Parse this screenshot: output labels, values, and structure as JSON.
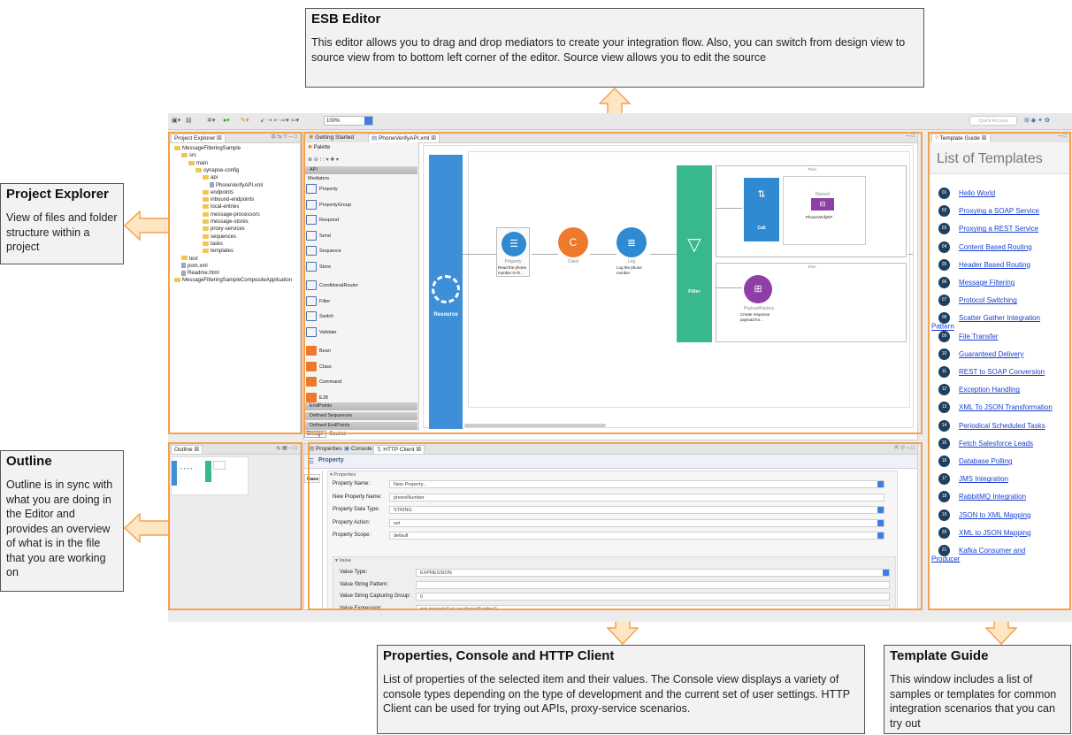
{
  "callouts": {
    "esb_editor": {
      "title": "ESB Editor",
      "text": "This editor allows you to drag and drop mediators to create your integration flow. Also, you can switch from design view to source view from to bottom left corner of the editor. Source view allows you to edit the source"
    },
    "project_explorer": {
      "title": "Project Explorer",
      "text": "View of files and folder structure within a project"
    },
    "outline": {
      "title": "Outline",
      "text": "Outline is in sync with what you are doing in the Editor and provides an overview of what is in the file that you are working on"
    },
    "properties": {
      "title": "Properties, Console and HTTP Client",
      "text": "List of properties of the selected item and their values. The Console view displays a variety of console types depending on the type of development and the current set of user settings. HTTP Client can be used for trying out APIs, proxy-service scenarios."
    },
    "template_guide": {
      "title": "Template Guide",
      "text": "This window includes a list of samples or templates for common integration scenarios that you can try out"
    }
  },
  "toolbar": {
    "zoom": "100%",
    "quick_access": "Quick Access"
  },
  "project_explorer": {
    "tab": "Project Explorer",
    "tree": [
      {
        "label": "MessageFilteringSample",
        "indent": 0,
        "kind": "folder"
      },
      {
        "label": "src",
        "indent": 1,
        "kind": "folder"
      },
      {
        "label": "main",
        "indent": 2,
        "kind": "folder"
      },
      {
        "label": "synapse-config",
        "indent": 3,
        "kind": "folder"
      },
      {
        "label": "api",
        "indent": 4,
        "kind": "folder"
      },
      {
        "label": "PhoneVerifyAPI.xml",
        "indent": 5,
        "kind": "file"
      },
      {
        "label": "endpoints",
        "indent": 4,
        "kind": "folder"
      },
      {
        "label": "inbound-endpoints",
        "indent": 4,
        "kind": "folder"
      },
      {
        "label": "local-entries",
        "indent": 4,
        "kind": "folder"
      },
      {
        "label": "message-processors",
        "indent": 4,
        "kind": "folder"
      },
      {
        "label": "message-stores",
        "indent": 4,
        "kind": "folder"
      },
      {
        "label": "proxy-services",
        "indent": 4,
        "kind": "folder"
      },
      {
        "label": "sequences",
        "indent": 4,
        "kind": "folder"
      },
      {
        "label": "tasks",
        "indent": 4,
        "kind": "folder"
      },
      {
        "label": "templates",
        "indent": 4,
        "kind": "folder"
      },
      {
        "label": "test",
        "indent": 1,
        "kind": "folder"
      },
      {
        "label": "pom.xml",
        "indent": 1,
        "kind": "file"
      },
      {
        "label": "Readme.html",
        "indent": 1,
        "kind": "file"
      },
      {
        "label": "MessageFilteringSampleCompositeApplication",
        "indent": 0,
        "kind": "folder"
      }
    ]
  },
  "editor": {
    "tabs": [
      "Getting Started",
      "PhoneVerifyAPI.xml"
    ],
    "palette_label": "Palette",
    "sections": {
      "api": "API",
      "mediators": "Mediators",
      "endpoints": "EndPoints",
      "defined_sequences": "Defined Sequences",
      "defined_endpoints": "Defined EndPoints"
    },
    "mediators": [
      "Property",
      "PropertyGroup",
      "Respond",
      "Send",
      "Sequence",
      "Store",
      "ConditionalRouter",
      "Filter",
      "Switch",
      "Validate",
      "Bean",
      "Class",
      "Command",
      "EJB"
    ],
    "bottom_tabs": [
      "Design",
      "Source"
    ],
    "canvas": {
      "resource": "Resource",
      "property": {
        "label": "Property",
        "desc": "Read the phone number in th..."
      },
      "class": {
        "label": "Class"
      },
      "log": {
        "label": "Log",
        "desc": "Log the phone number"
      },
      "filter": "Filter",
      "then": "Then",
      "else": "Else",
      "call": "Call",
      "named": "Named",
      "endpoint": "PhoneVerifyEP",
      "payload": {
        "label": "PayloadFactory",
        "desc": "Create response payload for..."
      }
    }
  },
  "outline": {
    "tab": "Outline"
  },
  "bottom": {
    "tabs": [
      "Properties",
      "Console",
      "HTTP Client"
    ],
    "header": "Property",
    "side_tab": "Base",
    "group": "Properties",
    "fields": [
      {
        "label": "Property Name:",
        "value": "New Property...",
        "type": "select"
      },
      {
        "label": "New Property Name:",
        "value": "phoneNumber",
        "type": "text"
      },
      {
        "label": "Property Data Type:",
        "value": "STRING",
        "type": "select"
      },
      {
        "label": "Property Action:",
        "value": "set",
        "type": "select"
      },
      {
        "label": "Property Scope:",
        "value": "default",
        "type": "select"
      }
    ],
    "value_group": "Value",
    "value_fields": [
      {
        "label": "Value Type:",
        "value": "EXPRESSION",
        "type": "select"
      },
      {
        "label": "Value String Pattern:",
        "value": "",
        "type": "text"
      },
      {
        "label": "Value String Capturing Group:",
        "value": "0",
        "type": "text"
      },
      {
        "label": "Value Expression:",
        "value": "get-property('uri.var.phoneNumber')",
        "type": "text"
      }
    ]
  },
  "template_guide": {
    "tab": "Template Guide",
    "heading": "List of Templates",
    "items": [
      {
        "num": "01",
        "label": "Hello World"
      },
      {
        "num": "02",
        "label": "Proxying a SOAP Service"
      },
      {
        "num": "03",
        "label": "Proxying a REST Service"
      },
      {
        "num": "04",
        "label": "Content Based Routing"
      },
      {
        "num": "05",
        "label": "Header Based Routing"
      },
      {
        "num": "06",
        "label": "Message Filtering"
      },
      {
        "num": "07",
        "label": "Protocol Switching"
      },
      {
        "num": "08",
        "label": "Scatter Gather Integration",
        "label2": "Pattern"
      },
      {
        "num": "09",
        "label": "File Transfer"
      },
      {
        "num": "10",
        "label": "Guaranteed Delivery"
      },
      {
        "num": "11",
        "label": "REST to SOAP Conversion"
      },
      {
        "num": "12",
        "label": "Exception Handling"
      },
      {
        "num": "13",
        "label": "XML To JSON Transformation"
      },
      {
        "num": "14",
        "label": "Periodical Scheduled Tasks"
      },
      {
        "num": "15",
        "label": "Fetch Salesforce Leads"
      },
      {
        "num": "16",
        "label": "Database Polling"
      },
      {
        "num": "17",
        "label": "JMS Integration"
      },
      {
        "num": "18",
        "label": "RabbitMQ Integration"
      },
      {
        "num": "19",
        "label": "JSON to XML Mapping"
      },
      {
        "num": "20",
        "label": "XML to JSON Mapping"
      },
      {
        "num": "21",
        "label": "Kafka Consumer and",
        "label2": "Producer"
      }
    ]
  },
  "colors": {
    "highlight": "#f4a24d",
    "resource": "#3d8fd8",
    "filter": "#37b88e",
    "link": "#1a3fcf"
  }
}
